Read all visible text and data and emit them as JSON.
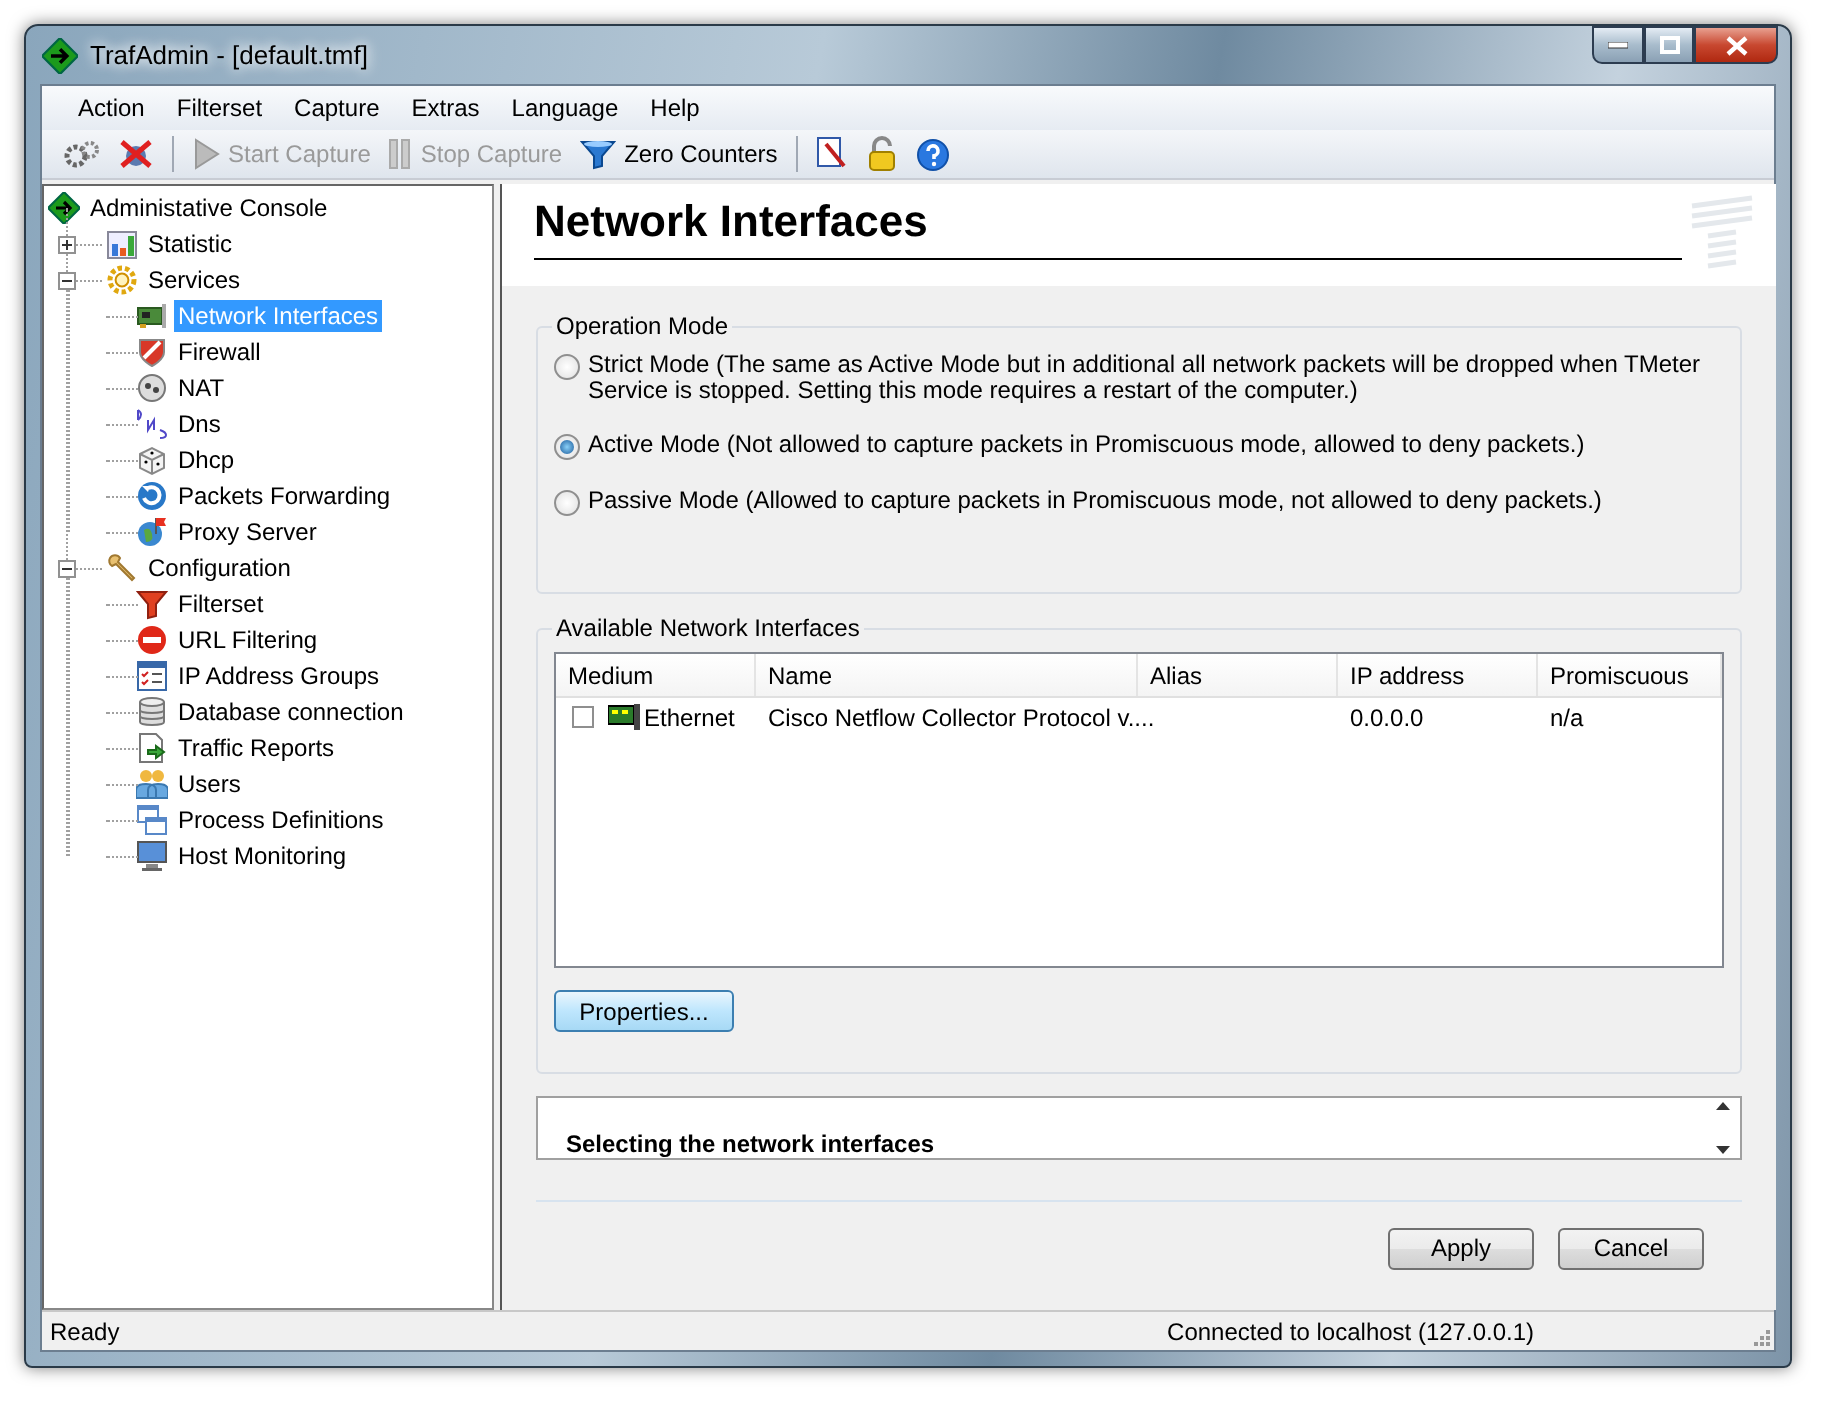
{
  "window": {
    "title": "TrafAdmin - [default.tmf]"
  },
  "menu": [
    {
      "label": "Action"
    },
    {
      "label": "Filterset"
    },
    {
      "label": "Capture"
    },
    {
      "label": "Extras"
    },
    {
      "label": "Language"
    },
    {
      "label": "Help"
    }
  ],
  "toolbar": [
    {
      "label": "Start Capture",
      "disabled": true
    },
    {
      "label": "Stop Capture",
      "disabled": true
    },
    {
      "label": "Zero Counters",
      "disabled": false
    }
  ],
  "tree": {
    "label": "Administative Console",
    "selected": false,
    "children": [
      {
        "label": "Statistic",
        "selected": false,
        "expanded": false
      },
      {
        "label": "Services",
        "selected": false,
        "expanded": true,
        "children": [
          {
            "label": "Network Interfaces",
            "selected": true
          },
          {
            "label": "Firewall",
            "selected": false
          },
          {
            "label": "NAT",
            "selected": false
          },
          {
            "label": "Dns",
            "selected": false
          },
          {
            "label": "Dhcp",
            "selected": false
          },
          {
            "label": "Packets Forwarding",
            "selected": false
          },
          {
            "label": "Proxy Server",
            "selected": false
          }
        ]
      },
      {
        "label": "Configuration",
        "selected": false,
        "expanded": true,
        "children": [
          {
            "label": "Filterset",
            "selected": false
          },
          {
            "label": "URL Filtering",
            "selected": false
          },
          {
            "label": "IP Address Groups",
            "selected": false
          },
          {
            "label": "Database connection",
            "selected": false
          },
          {
            "label": "Traffic Reports",
            "selected": false
          },
          {
            "label": "Users",
            "selected": false
          },
          {
            "label": "Process Definitions",
            "selected": false
          },
          {
            "label": "Host Monitoring",
            "selected": false
          }
        ]
      }
    ]
  },
  "page": {
    "title": "Network Interfaces",
    "operation_mode": {
      "legend": "Operation Mode",
      "options": [
        {
          "label": "Strict Mode (The same as Active Mode but in additional all network packets will be dropped when TMeter Service is stopped. Setting this mode requires a restart of the computer.)",
          "selected": false
        },
        {
          "label": "Active Mode (Not allowed to capture packets in Promiscuous mode, allowed to deny packets.)",
          "selected": true
        },
        {
          "label": "Passive Mode (Allowed to capture packets in Promiscuous mode, not allowed to deny packets.)",
          "selected": false
        }
      ]
    },
    "interfaces": {
      "legend": "Available Network Interfaces",
      "columns": [
        "Medium",
        "Name",
        "Alias",
        "IP address",
        "Promiscuous"
      ],
      "rows": [
        {
          "checked": false,
          "cells": [
            "Ethernet",
            "Cisco Netflow Collector Protocol v....",
            "",
            "0.0.0.0",
            "n/a"
          ]
        }
      ],
      "button": "Properties..."
    },
    "help": {
      "heading": "Selecting the network interfaces"
    },
    "buttons": [
      "Apply",
      "Cancel"
    ]
  },
  "status_bar": {
    "left": "Ready",
    "right": "Connected to localhost (127.0.0.1)"
  }
}
